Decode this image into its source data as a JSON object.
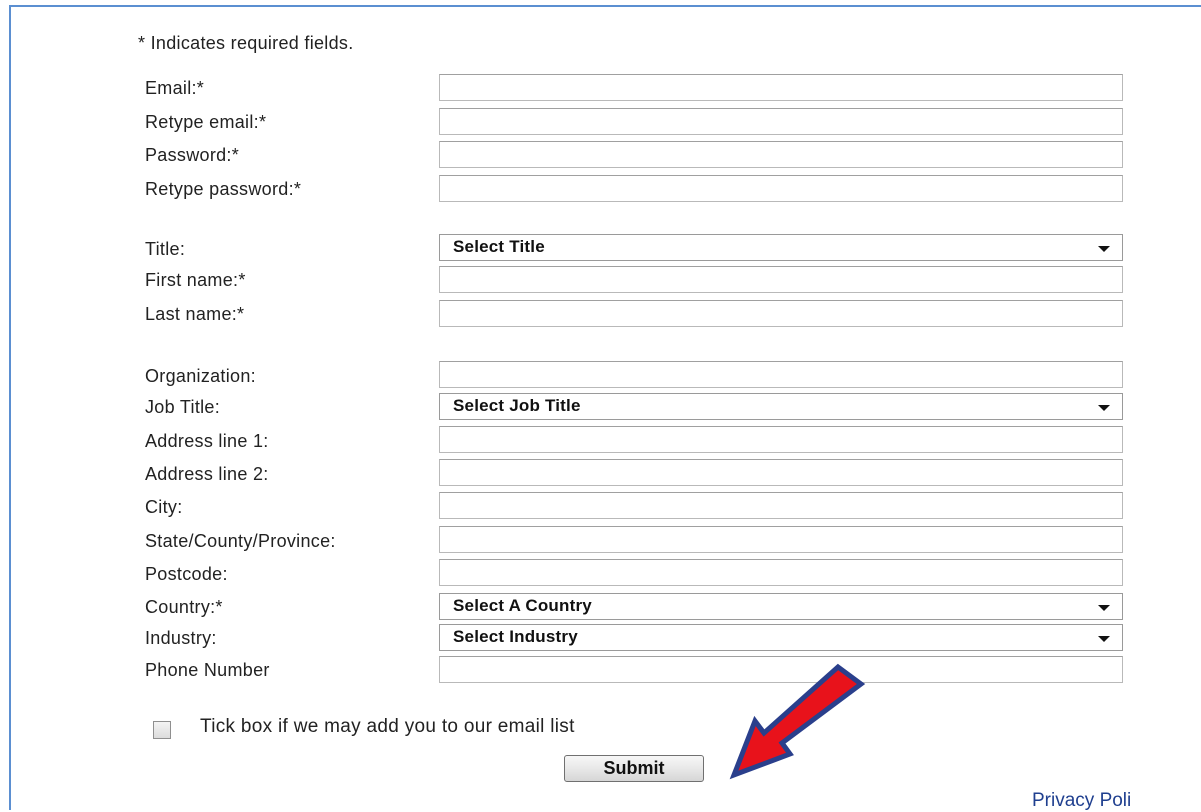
{
  "form": {
    "required_note": "* Indicates required fields.",
    "fields": [
      {
        "label": "Email:*",
        "type": "text",
        "value": ""
      },
      {
        "label": "Retype email:*",
        "type": "text",
        "value": ""
      },
      {
        "label": "Password:*",
        "type": "text",
        "value": ""
      },
      {
        "label": "Retype password:*",
        "type": "text",
        "value": ""
      },
      {
        "label": "Title:",
        "type": "select",
        "value": "Select Title"
      },
      {
        "label": "First name:*",
        "type": "text",
        "value": ""
      },
      {
        "label": "Last name:*",
        "type": "text",
        "value": ""
      },
      {
        "label": "Organization:",
        "type": "text",
        "value": ""
      },
      {
        "label": "Job Title:",
        "type": "select",
        "value": "Select Job Title"
      },
      {
        "label": "Address line 1:",
        "type": "text",
        "value": ""
      },
      {
        "label": "Address line 2:",
        "type": "text",
        "value": ""
      },
      {
        "label": "City:",
        "type": "text",
        "value": ""
      },
      {
        "label": "State/County/Province:",
        "type": "text",
        "value": ""
      },
      {
        "label": "Postcode:",
        "type": "text",
        "value": ""
      },
      {
        "label": "Country:*",
        "type": "select",
        "value": "Select A Country"
      },
      {
        "label": "Industry:",
        "type": "select",
        "value": "Select Industry"
      },
      {
        "label": "Phone Number",
        "type": "text",
        "value": ""
      }
    ],
    "email_list_checkbox": {
      "label": "Tick box if we may add you to our email list",
      "checked": false
    },
    "submit_label": "Submit"
  },
  "footer": {
    "privacy_link": "Privacy Poli"
  },
  "annotation": {
    "arrow_color": "#e8121b",
    "arrow_outline": "#2a3f8c",
    "points_to": "submit-button"
  }
}
